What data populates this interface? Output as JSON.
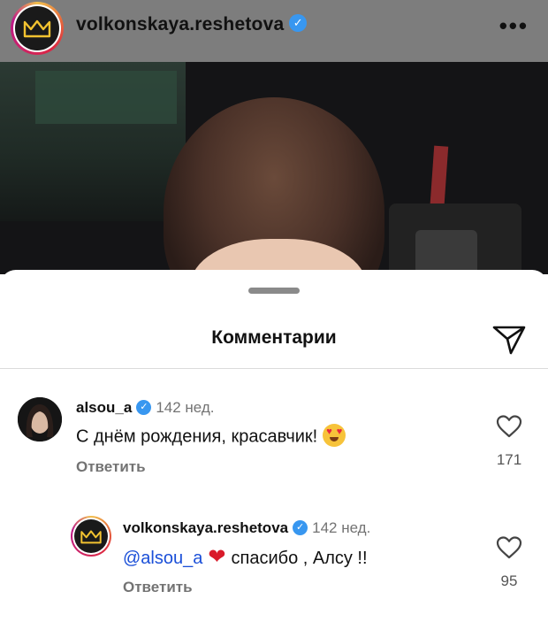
{
  "header": {
    "username": "volkonskaya.reshetova",
    "verified_icon": "verified-badge-icon",
    "more_icon": "more-options-icon",
    "more_label": "•••"
  },
  "sheet": {
    "title": "Комментарии",
    "share_icon": "send-icon"
  },
  "comments": [
    {
      "username": "alsou_a",
      "age": "142 нед.",
      "text": "С днём рождения, красавчик!",
      "emoji": "heart-eyes-emoji",
      "reply_label": "Ответить",
      "likes": "171"
    },
    {
      "username": "volkonskaya.reshetova",
      "age": "142 нед.",
      "mention": "@alsou_a",
      "emoji": "red-heart-emoji",
      "text": "спасибо , Алсу !!",
      "reply_label": "Ответить",
      "likes": "95"
    }
  ],
  "colors": {
    "accent": "#3897f0",
    "mention": "#1a4fd8",
    "muted": "#737373"
  }
}
